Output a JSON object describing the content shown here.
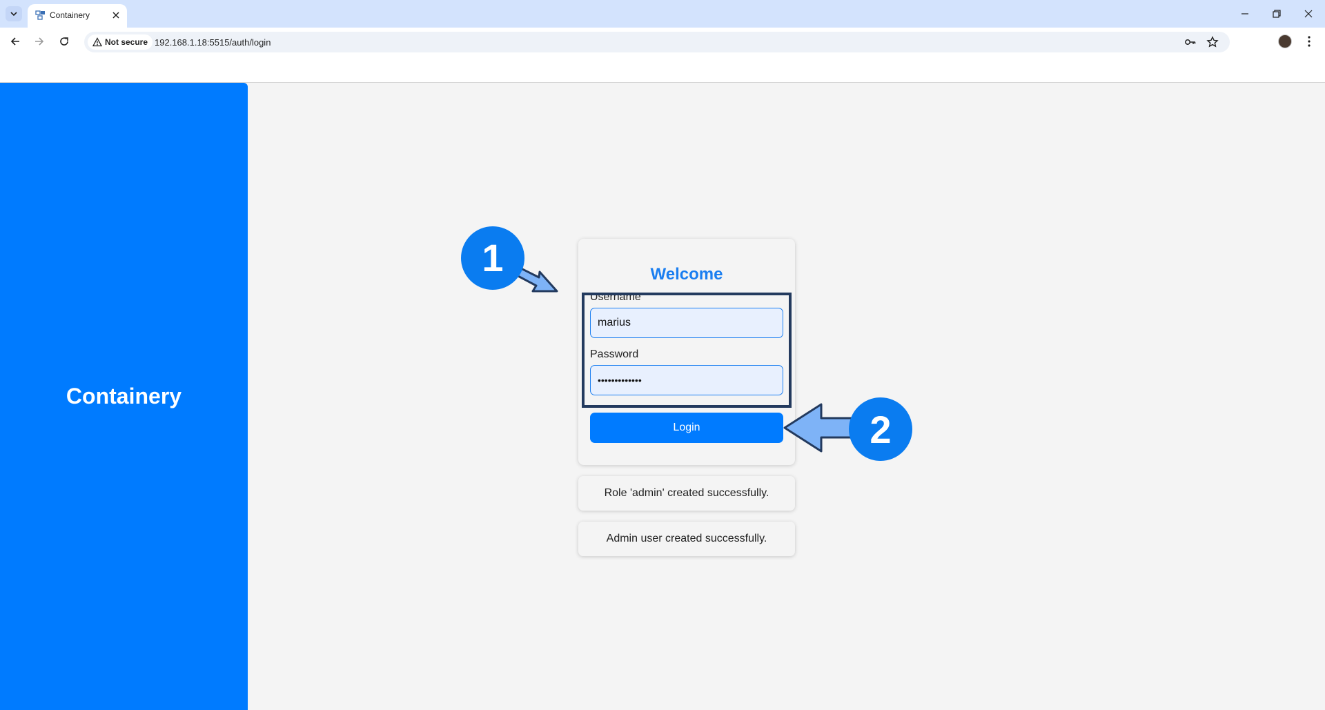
{
  "browser": {
    "tab_title": "Containery",
    "security_label": "Not secure",
    "url": "192.168.1.18:5515/auth/login"
  },
  "app": {
    "brand": "Containery"
  },
  "login": {
    "title": "Welcome",
    "username_label": "Username",
    "username_value": "marius",
    "password_label": "Password",
    "password_value": "•••••••••••••",
    "login_button": "Login"
  },
  "messages": [
    "Role 'admin' created successfully.",
    "Admin user created successfully."
  ],
  "annotations": {
    "step1": "1",
    "step2": "2"
  },
  "colors": {
    "primary": "#007bff",
    "title": "#1a7ef0",
    "annotation_arrow": "#7eb3f7",
    "annotation_outline": "#233a5e"
  }
}
